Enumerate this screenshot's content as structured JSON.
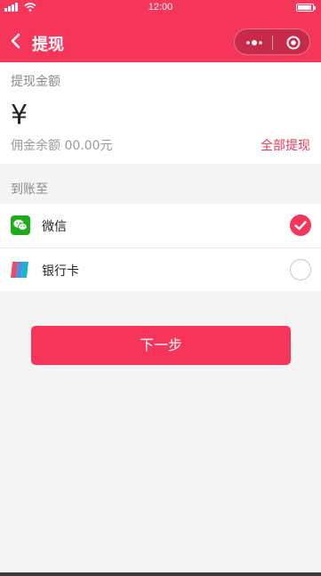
{
  "status_bar": {
    "time": "12:00"
  },
  "nav": {
    "title": "提现"
  },
  "amount": {
    "label": "提现金额",
    "currency_symbol": "¥",
    "balance_text": "佣金余额 00.00元",
    "withdraw_all": "全部提现"
  },
  "arrive": {
    "label": "到账至",
    "methods": [
      {
        "label": "微信",
        "icon": "wechat-icon",
        "selected": true
      },
      {
        "label": "银行卡",
        "icon": "bank-card-icon",
        "selected": false
      }
    ]
  },
  "next_button": "下一步",
  "colors": {
    "accent": "#f5355a",
    "wechat_green": "#1aad19",
    "background": "#f4f4f4"
  }
}
